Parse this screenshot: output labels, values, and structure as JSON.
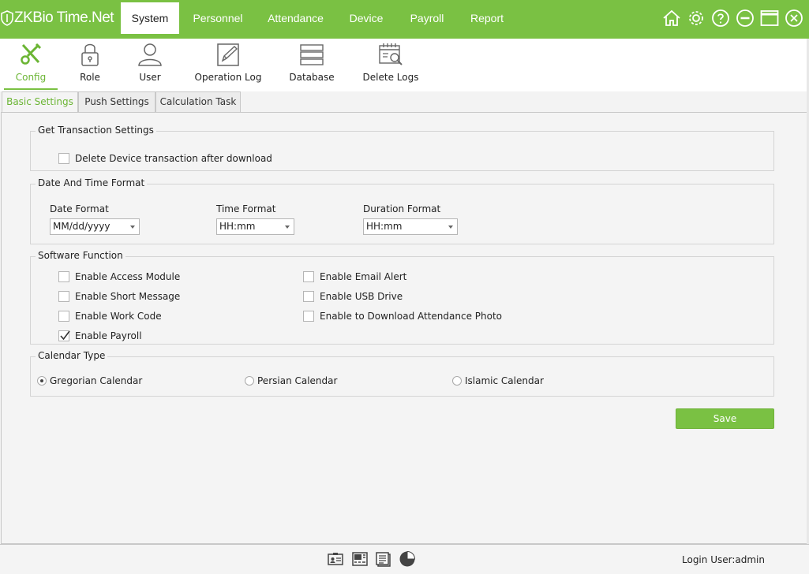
{
  "app": {
    "brand": "ZKBio Time.Net"
  },
  "nav": {
    "items": [
      {
        "label": "System",
        "active": true
      },
      {
        "label": "Personnel"
      },
      {
        "label": "Attendance"
      },
      {
        "label": "Device"
      },
      {
        "label": "Payroll"
      },
      {
        "label": "Report"
      }
    ]
  },
  "window_icons": [
    "home-icon",
    "gear-icon",
    "help-icon",
    "minimize-icon",
    "maximize-icon",
    "close-icon"
  ],
  "tools": {
    "items": [
      {
        "label": "Config",
        "icon": "wrench-screwdriver-icon",
        "active": true
      },
      {
        "label": "Role",
        "icon": "lock-icon"
      },
      {
        "label": "User",
        "icon": "user-icon"
      },
      {
        "label": "Operation Log",
        "icon": "log-edit-icon"
      },
      {
        "label": "Database",
        "icon": "database-icon"
      },
      {
        "label": "Delete Logs",
        "icon": "delete-logs-icon"
      }
    ]
  },
  "tabs": [
    {
      "label": "Basic Settings",
      "active": true
    },
    {
      "label": "Push Settings"
    },
    {
      "label": "Calculation Task"
    }
  ],
  "transaction": {
    "legend": "Get Transaction Settings",
    "delete_after_download": {
      "label": "Delete Device transaction after download",
      "checked": false
    }
  },
  "datetime": {
    "legend": "Date And Time Format",
    "date_format": {
      "label": "Date Format",
      "value": "MM/dd/yyyy"
    },
    "time_format": {
      "label": "Time Format",
      "value": "HH:mm"
    },
    "duration_format": {
      "label": "Duration Format",
      "value": "HH:mm"
    }
  },
  "software": {
    "legend": "Software Function",
    "options": [
      {
        "label": "Enable Access Module",
        "checked": false
      },
      {
        "label": "Enable Short Message",
        "checked": false
      },
      {
        "label": "Enable Work Code",
        "checked": false
      },
      {
        "label": "Enable Payroll",
        "checked": true
      },
      {
        "label": "Enable Email Alert",
        "checked": false
      },
      {
        "label": "Enable USB Drive",
        "checked": false
      },
      {
        "label": "Enable to Download Attendance Photo",
        "checked": false
      }
    ]
  },
  "calendar": {
    "legend": "Calendar Type",
    "options": [
      {
        "label": "Gregorian Calendar",
        "checked": true
      },
      {
        "label": "Persian Calendar",
        "checked": false
      },
      {
        "label": "Islamic Calendar",
        "checked": false
      }
    ]
  },
  "actions": {
    "save_label": "Save"
  },
  "status": {
    "icons": [
      "id-card-icon",
      "device-icon",
      "clipboard-icon",
      "pie-chart-icon"
    ],
    "login_user": "Login User:admin"
  },
  "colors": {
    "accent": "#7ac143",
    "active_text": "#6bb534"
  }
}
